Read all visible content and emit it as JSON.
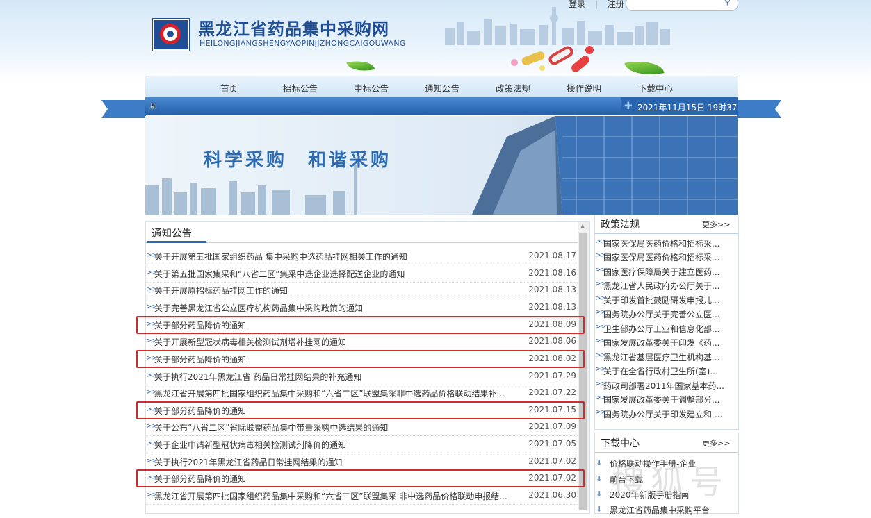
{
  "site": {
    "title": "黑龙江省药品集中采购网",
    "subtitle": "HEILONGJIANGSHENGYAOPINJIZHONGCAIGOUWANG"
  },
  "top_links": {
    "login": "登录",
    "register": "注册",
    "search_placeholder": ""
  },
  "nav": [
    "首页",
    "招标公告",
    "中标公告",
    "通知公告",
    "政策法规",
    "操作说明",
    "下载中心"
  ],
  "status_bar": {
    "datetime": "2021年11月15日 19时37"
  },
  "banner": {
    "slogan": "科学采购　和谐采购"
  },
  "notices": {
    "tab_label": "通知公告",
    "items": [
      {
        "title": "关于开展第五批国家组织药品 集中采购中选药品挂网相关工作的通知",
        "date": "2021.08.17",
        "highlight": false
      },
      {
        "title": "关于第五批国家集采和“八省二区”集采中选企业选择配送企业的通知",
        "date": "2021.08.16",
        "highlight": false
      },
      {
        "title": "关于开展原招标药品挂网工作的通知",
        "date": "2021.08.13",
        "highlight": false
      },
      {
        "title": "关于完善黑龙江省公立医疗机构药品集中采购政策的通知",
        "date": "2021.08.13",
        "highlight": false
      },
      {
        "title": "关于部分药品降价的通知",
        "date": "2021.08.09",
        "highlight": true
      },
      {
        "title": "关于开展新型冠状病毒相关检测试剂增补挂网的通知",
        "date": "2021.08.06",
        "highlight": false
      },
      {
        "title": "关于部分药品降价的通知",
        "date": "2021.08.02",
        "highlight": true
      },
      {
        "title": "关于执行2021年黑龙江省 药品日常挂网结果的补充通知",
        "date": "2021.07.29",
        "highlight": false
      },
      {
        "title": "黑龙江省开展第四批国家组织药品集中采购和“六省二区”联盟集采非中选药品价格联动结果补...",
        "date": "2021.07.22",
        "highlight": false
      },
      {
        "title": "关于部分药品降价的通知",
        "date": "2021.07.15",
        "highlight": true
      },
      {
        "title": "关于公布“八省二区”省际联盟药品集中带量采购中选结果的通知",
        "date": "2021.07.09",
        "highlight": false
      },
      {
        "title": "关于企业申请新型冠状病毒相关检测试剂降价的通知",
        "date": "2021.07.05",
        "highlight": false
      },
      {
        "title": "关于执行2021年黑龙江省药品日常挂网结果的通知",
        "date": "2021.07.02",
        "highlight": false
      },
      {
        "title": "关于部分药品降价的通知",
        "date": "2021.07.02",
        "highlight": true
      },
      {
        "title": "黑龙江省开展第四批国家组织药品集中采购和“六省二区”联盟集采 非中选药品价格联动申报结...",
        "date": "2021.06.30",
        "highlight": false
      }
    ]
  },
  "policy": {
    "title": "政策法规",
    "more": "更多>>",
    "items": [
      "国家医保局医药价格和招标采...",
      "国家医保局医药价格和招标采...",
      "国家医疗保障局关于建立医药...",
      "黑龙江省人民政府办公厅关于...",
      "关于印发首批鼓励研发申报儿...",
      "国务院办公厅关于完善公立医...",
      "卫生部办公厅工业和信息化部...",
      "国家发展改革委关于印发《药...",
      "黑龙江省基层医疗卫生机构基...",
      "关于在全省行政村卫生所(室)...",
      "药政司部署2011年国家基本药...",
      "国家发展改革委关于调整部分...",
      "国务院办公厅关于印发建立和 ..."
    ]
  },
  "downloads": {
    "title": "下载中心",
    "more": "更多>>",
    "items": [
      "价格联动操作手册-企业",
      "前台下载",
      "2020年新版手册指南",
      "黑龙江省药品集中采购平台"
    ]
  },
  "watermark": {
    "text": "搜狐号"
  },
  "colors": {
    "brand_blue": "#1f4e96",
    "bar_blue": "#2a65b0",
    "highlight_red": "#d22b2b"
  }
}
